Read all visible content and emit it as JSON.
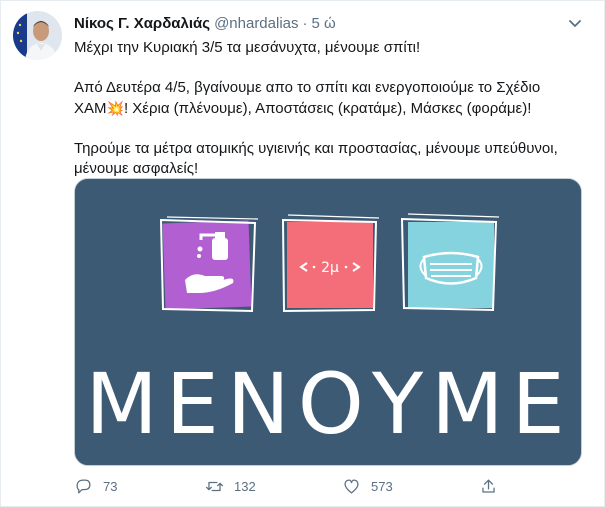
{
  "tweet": {
    "author_name": "Νίκος Γ. Χαρδαλιάς",
    "handle": "@nhardalias",
    "separator": "·",
    "time": "5 ώ",
    "lines": [
      "Μέχρι την Κυριακή 3/5 τα μεσάνυχτα, μένουμε σπίτι!",
      "Από Δευτέρα 4/5, βγαίνουμε απο το σπίτι και ενεργοποιούμε το Σχέδιο",
      "ΧΑΜ",
      "! Χέρια (πλένουμε), Αποστάσεις (κρατάμε), Μάσκες (φοράμε)!",
      "Τηρούμε τα μέτρα ατομικής υγιεινής και προστασίας, μένουμε υπεύθυνοι,",
      "μένουμε ασφαλείς!"
    ],
    "emoji": "💥"
  },
  "media": {
    "distance_label": "2μ",
    "headline": "ΜΕΝΟΥΜΕ",
    "background_color": "#3d5a75",
    "panel_colors": [
      "#b15fd1",
      "#f46e7a",
      "#86d3e0"
    ]
  },
  "actions": {
    "replies": "73",
    "retweets": "132",
    "likes": "573"
  },
  "icons": [
    "avatar",
    "caret-down-icon",
    "hand-sanitizer-icon",
    "distance-arrows-icon",
    "face-mask-icon",
    "reply-icon",
    "retweet-icon",
    "like-icon",
    "share-icon"
  ]
}
